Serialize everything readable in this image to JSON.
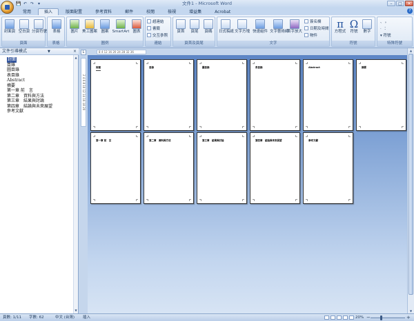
{
  "window": {
    "title": "文件1 - Microsoft Word",
    "minimize": "–",
    "maximize": "□",
    "close": "✕"
  },
  "quick_access": {
    "save": "💾",
    "undo": "↶",
    "redo": "↷",
    "more": "▾"
  },
  "ribbon_tabs": [
    {
      "label": "常用"
    },
    {
      "label": "插入",
      "active": true
    },
    {
      "label": "版面配置"
    },
    {
      "label": "參考資料"
    },
    {
      "label": "郵件"
    },
    {
      "label": "校閱"
    },
    {
      "label": "檢視"
    },
    {
      "label": "增益集"
    },
    {
      "label": "Acrobat"
    }
  ],
  "help": "?",
  "ribbon": {
    "pages": {
      "label": "頁面",
      "cover": "封面頁",
      "blank": "空白頁",
      "page_break": "分頁符號"
    },
    "tables": {
      "label": "表格",
      "table": "表格"
    },
    "illustrations": {
      "label": "圖例",
      "picture": "圖片",
      "clipart": "美工圖案",
      "shapes": "圖案",
      "smartart": "SmartArt",
      "chart": "圖表"
    },
    "links": {
      "label": "連結",
      "hyperlink": "超連結",
      "bookmark": "書籤",
      "crossref": "交互參照"
    },
    "header_footer": {
      "label": "頁首及頁尾",
      "header": "頁首",
      "footer": "頁尾",
      "page_number": "頁碼"
    },
    "text": {
      "label": "文字",
      "textbox": "文字方塊",
      "quickparts": "快速組件",
      "wordart": "文字藝術師",
      "dropcap": "首字放大",
      "signature": "簽名欄",
      "datetime": "日期及時間",
      "object": "物件",
      "chinese_layout": "日式稿紙"
    },
    "symbols": {
      "label": "符號",
      "equation": "方程式",
      "symbol": "符號",
      "number": "數字"
    },
    "special": {
      "label": "特殊符號",
      "symbol": "符號"
    }
  },
  "nav_pane": {
    "title": "文件引導模式",
    "close": "×",
    "items": [
      {
        "label": "封面",
        "selected": true
      },
      {
        "label": "目錄"
      },
      {
        "label": "圖目錄"
      },
      {
        "label": "表目錄"
      },
      {
        "label": "Abstract"
      },
      {
        "label": "摘要"
      },
      {
        "label": "第一章 前　言"
      },
      {
        "label": "第二章　資料與方法"
      },
      {
        "label": "第三章　結果與討論"
      },
      {
        "label": "第四章　結論與未來展望"
      },
      {
        "label": "參考文獻"
      }
    ]
  },
  "ruler": {
    "corner": "L",
    "h_ticks": "8  4  12 16 20 24 28 32 36",
    "v_ticks": "2 4 6 8 10 12 14 16 18 20"
  },
  "pages": [
    {
      "title": "封面",
      "underline": true
    },
    {
      "title": "目錄"
    },
    {
      "title": "圖目錄"
    },
    {
      "title": "表目錄"
    },
    {
      "title": "Abstract"
    },
    {
      "title": "摘要"
    },
    {
      "title": "第一章 前　言"
    },
    {
      "title": "第二章　資料與方法"
    },
    {
      "title": "第三章　結果與討論"
    },
    {
      "title": "第四章　結論與未來展望"
    },
    {
      "title": "參考文獻"
    }
  ],
  "status": {
    "page": "頁數: 1/11",
    "words": "字數: 62",
    "language": "中文 (台灣)",
    "mode": "插入",
    "zoom": "20%",
    "zoom_minus": "−",
    "zoom_plus": "+"
  }
}
